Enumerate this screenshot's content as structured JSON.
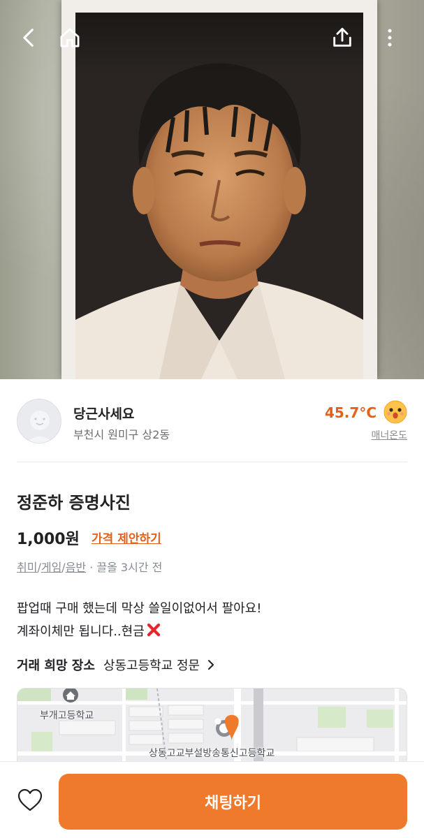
{
  "header": {
    "back_icon": "chevron-left-icon",
    "home_icon": "home-icon",
    "share_icon": "share-icon",
    "more_icon": "more-vertical-icon"
  },
  "seller": {
    "name": "당근사세요",
    "region": "부천시 원미구 상2동",
    "manner_temp": "45.7°C",
    "manner_label": "매너온도",
    "temp_color": "#e4611c"
  },
  "listing": {
    "title": "정준하 증명사진",
    "price": "1,000원",
    "offer_link": "가격 제안하기",
    "category_parts": [
      "취미",
      "게임",
      "음반"
    ],
    "category_sep": "/",
    "meta_suffix": " · 끌올 3시간 전",
    "description_line1": "팝업때 구매 했는데 막상 쓸일이없어서 팔아요!",
    "description_line2": "계좌이체만 됩니다..현금"
  },
  "place": {
    "label": "거래 희망 장소",
    "name": "상동고등학교 정문"
  },
  "map": {
    "labels": {
      "school_1": "부개고등학교",
      "school_2": "상동고교부설방송통신고등학교"
    }
  },
  "bottom": {
    "chat_label": "채팅하기",
    "like_icon": "heart-outline-icon",
    "accent": "#f07a2c"
  }
}
